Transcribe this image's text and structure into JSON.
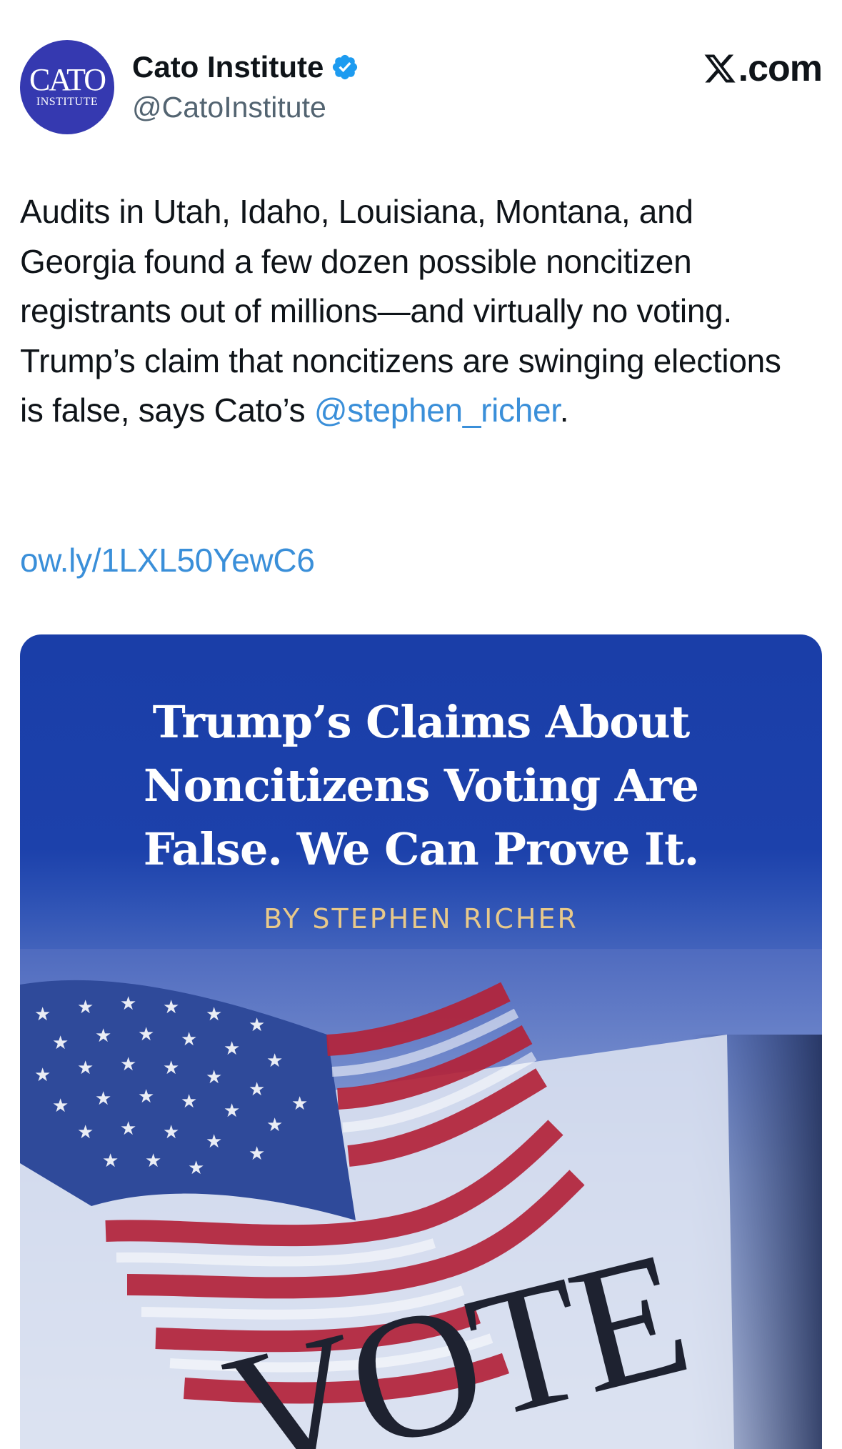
{
  "account": {
    "display_name": "Cato Institute",
    "handle": "@CatoInstitute",
    "avatar_text_main": "CATO",
    "avatar_text_sub": "INSTITUTE",
    "verified": true
  },
  "site": {
    "label": ".com"
  },
  "tweet": {
    "text_main": "Audits in Utah, Idaho, Louisiana, Montana, and Georgia found a few dozen possible noncitizen registrants out of millions—and virtually no voting. Trump’s claim that noncitizens are swinging elections is false, says Cato’s ",
    "mention": "@stephen_richer",
    "text_end": ".",
    "link": "ow.ly/1LXL50YewC6"
  },
  "card": {
    "title_line1": "Trump’s Claims About",
    "title_line2": "Noncitizens Voting Are",
    "title_line3": "False. We Can Prove It.",
    "byline": "BY STEPHEN RICHER",
    "image_text": "VOTE"
  },
  "colors": {
    "avatar_bg": "#3539b0",
    "link": "#3a8fd9",
    "verified": "#1d9bf0",
    "card_bg": "#1a3ea8",
    "byline": "#e8c98a",
    "flag_red": "#b3233a"
  },
  "icons": {
    "verified": "verified-badge-icon",
    "brand": "x-logo-icon"
  }
}
